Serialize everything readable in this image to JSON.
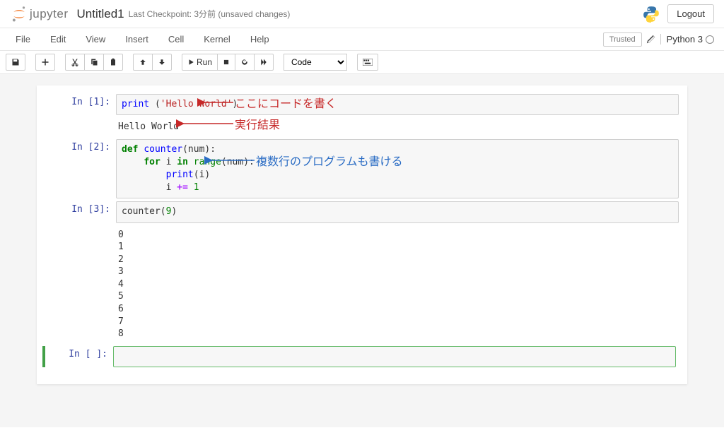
{
  "header": {
    "logo_text": "jupyter",
    "title": "Untitled1",
    "checkpoint": "Last Checkpoint: 3分前   (unsaved changes)",
    "logout": "Logout"
  },
  "menubar": {
    "items": [
      "File",
      "Edit",
      "View",
      "Insert",
      "Cell",
      "Kernel",
      "Help"
    ],
    "trusted": "Trusted",
    "kernel": "Python 3"
  },
  "toolbar": {
    "run_label": "Run",
    "celltype": "Code"
  },
  "cells": [
    {
      "prompt": "In [1]:",
      "code_tokens": [
        {
          "t": "print",
          "c": "bn"
        },
        {
          "t": " (",
          "c": ""
        },
        {
          "t": "'Hello World'",
          "c": "str"
        },
        {
          "t": ")",
          "c": ""
        }
      ],
      "output": "Hello World"
    },
    {
      "prompt": "In [2]:",
      "code_tokens": [
        {
          "t": "def",
          "c": "kw"
        },
        {
          "t": " ",
          "c": ""
        },
        {
          "t": "counter",
          "c": "bn"
        },
        {
          "t": "(num):\n    ",
          "c": ""
        },
        {
          "t": "for",
          "c": "kw"
        },
        {
          "t": " i ",
          "c": ""
        },
        {
          "t": "in",
          "c": "kw"
        },
        {
          "t": " ",
          "c": ""
        },
        {
          "t": "range",
          "c": "fn"
        },
        {
          "t": "(num):\n        ",
          "c": ""
        },
        {
          "t": "print",
          "c": "bn"
        },
        {
          "t": "(i)\n        i ",
          "c": ""
        },
        {
          "t": "+=",
          "c": "op"
        },
        {
          "t": " ",
          "c": ""
        },
        {
          "t": "1",
          "c": "num"
        }
      ],
      "output": ""
    },
    {
      "prompt": "In [3]:",
      "code_tokens": [
        {
          "t": "counter(",
          "c": ""
        },
        {
          "t": "9",
          "c": "num"
        },
        {
          "t": ")",
          "c": ""
        }
      ],
      "output": "0\n1\n2\n3\n4\n5\n6\n7\n8"
    },
    {
      "prompt": "In [ ]:",
      "code_tokens": [
        {
          "t": " ",
          "c": ""
        }
      ],
      "output": "",
      "selected": true
    }
  ],
  "annotations": {
    "a1": "ここにコードを書く",
    "a2": "実行結果",
    "a3": "複数行のプログラムも書ける"
  }
}
